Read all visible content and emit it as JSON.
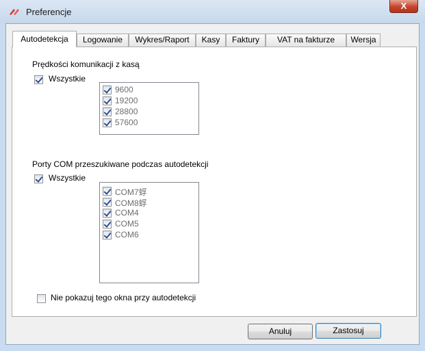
{
  "window": {
    "title": "Preferencje",
    "close_label": "X"
  },
  "tabs": [
    {
      "label": "Autodetekcja",
      "active": true
    },
    {
      "label": "Logowanie"
    },
    {
      "label": "Wykres/Raport"
    },
    {
      "label": "Kasy"
    },
    {
      "label": "Faktury"
    },
    {
      "label": "VAT na fakturze"
    },
    {
      "label": "Wersja"
    }
  ],
  "speeds": {
    "heading": "Prędkości  komunikacji z kasą",
    "all_label": "Wszystkie",
    "all_checked": true,
    "items": [
      {
        "label": "9600",
        "checked": true
      },
      {
        "label": "19200",
        "checked": true
      },
      {
        "label": "28800",
        "checked": true
      },
      {
        "label": "57600",
        "checked": true
      }
    ]
  },
  "ports": {
    "heading": "Porty COM przeszukiwane podczas autodetekcji",
    "all_label": "Wszystkie",
    "all_checked": true,
    "items": [
      {
        "label": "COM7蜉",
        "checked": true
      },
      {
        "label": "COM8蜉",
        "checked": true
      },
      {
        "label": "COM4",
        "checked": true
      },
      {
        "label": "COM5",
        "checked": true
      },
      {
        "label": "COM6",
        "checked": true
      }
    ]
  },
  "no_show": {
    "label": "Nie pokazuj tego okna przy autodetekcji",
    "checked": false
  },
  "buttons": {
    "cancel": "Anuluj",
    "apply": "Zastosuj"
  }
}
